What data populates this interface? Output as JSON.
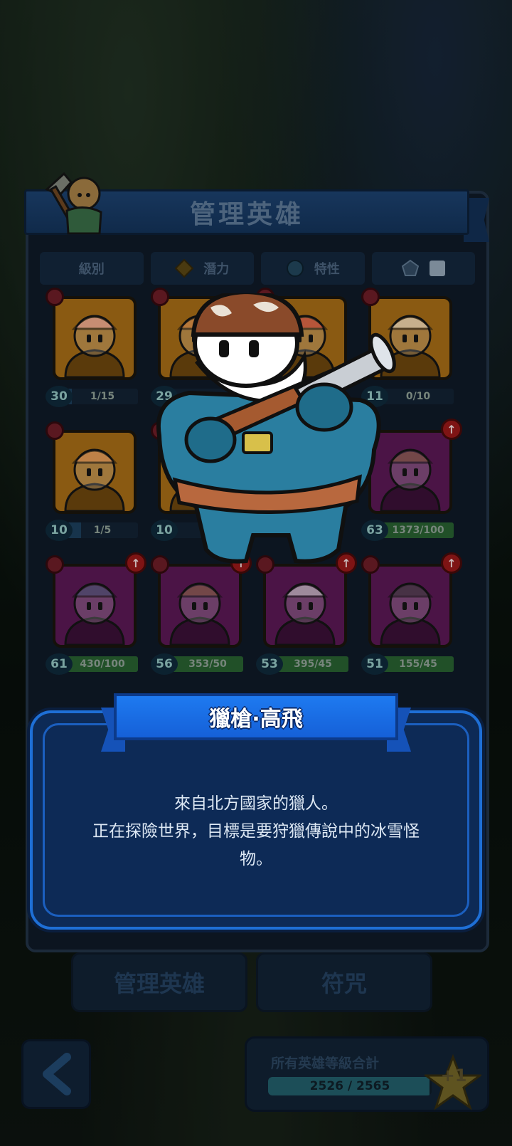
{
  "screen": {
    "title": "管理英雄"
  },
  "filters": [
    {
      "label": "級別",
      "icon": "none"
    },
    {
      "label": "潛力",
      "icon": "diamond-icon"
    },
    {
      "label": "特性",
      "icon": "orb-icon"
    },
    {
      "label": "",
      "icon": "pentagon-icon"
    }
  ],
  "heroes": [
    {
      "level": "30",
      "xp": "1/15",
      "progress": 0.07,
      "frame": "gold",
      "face": "pig"
    },
    {
      "level": "29",
      "xp": "",
      "progress": 0.0,
      "frame": "gold",
      "face": "hat"
    },
    {
      "level": "",
      "xp": "",
      "progress": 0.0,
      "frame": "gold",
      "face": "red"
    },
    {
      "level": "11",
      "xp": "0/10",
      "progress": 0.0,
      "frame": "gold",
      "face": "horn"
    },
    {
      "level": "10",
      "xp": "1/5",
      "progress": 0.2,
      "frame": "gold",
      "face": "girl"
    },
    {
      "level": "10",
      "xp": "",
      "progress": 0.0,
      "frame": "gold",
      "face": "hidden"
    },
    {
      "level": "",
      "xp": "",
      "progress": 1.0,
      "frame": "purple",
      "face": "hidden"
    },
    {
      "level": "63",
      "xp": "1373/100",
      "progress": 1.0,
      "frame": "purple",
      "face": "cowboy"
    },
    {
      "level": "61",
      "xp": "430/100",
      "progress": 1.0,
      "frame": "purple",
      "face": "viking"
    },
    {
      "level": "56",
      "xp": "353/50",
      "progress": 1.0,
      "frame": "purple",
      "face": "hunter"
    },
    {
      "level": "53",
      "xp": "395/45",
      "progress": 1.0,
      "frame": "purple",
      "face": "knight"
    },
    {
      "level": "51",
      "xp": "155/45",
      "progress": 1.0,
      "frame": "purple",
      "face": "tophat"
    }
  ],
  "bottom_tabs": {
    "manage": "管理英雄",
    "runes": "符咒"
  },
  "total": {
    "label": "所有英雄等級合計",
    "value": "2526 / 2565",
    "progress": 0.985,
    "star_bonus": "+1"
  },
  "dialog": {
    "hero_name": "獵槍·高飛",
    "description_lines": [
      "來自北方國家的獵人。",
      "正在探險世界，目標是要狩獵傳說中的冰雪怪",
      "物。"
    ]
  },
  "colors": {
    "dialog_border": "#1e6fd6",
    "name_banner": "#1e7af0",
    "gold_frame": "#8a5a12",
    "purple_frame": "#4b1446"
  }
}
